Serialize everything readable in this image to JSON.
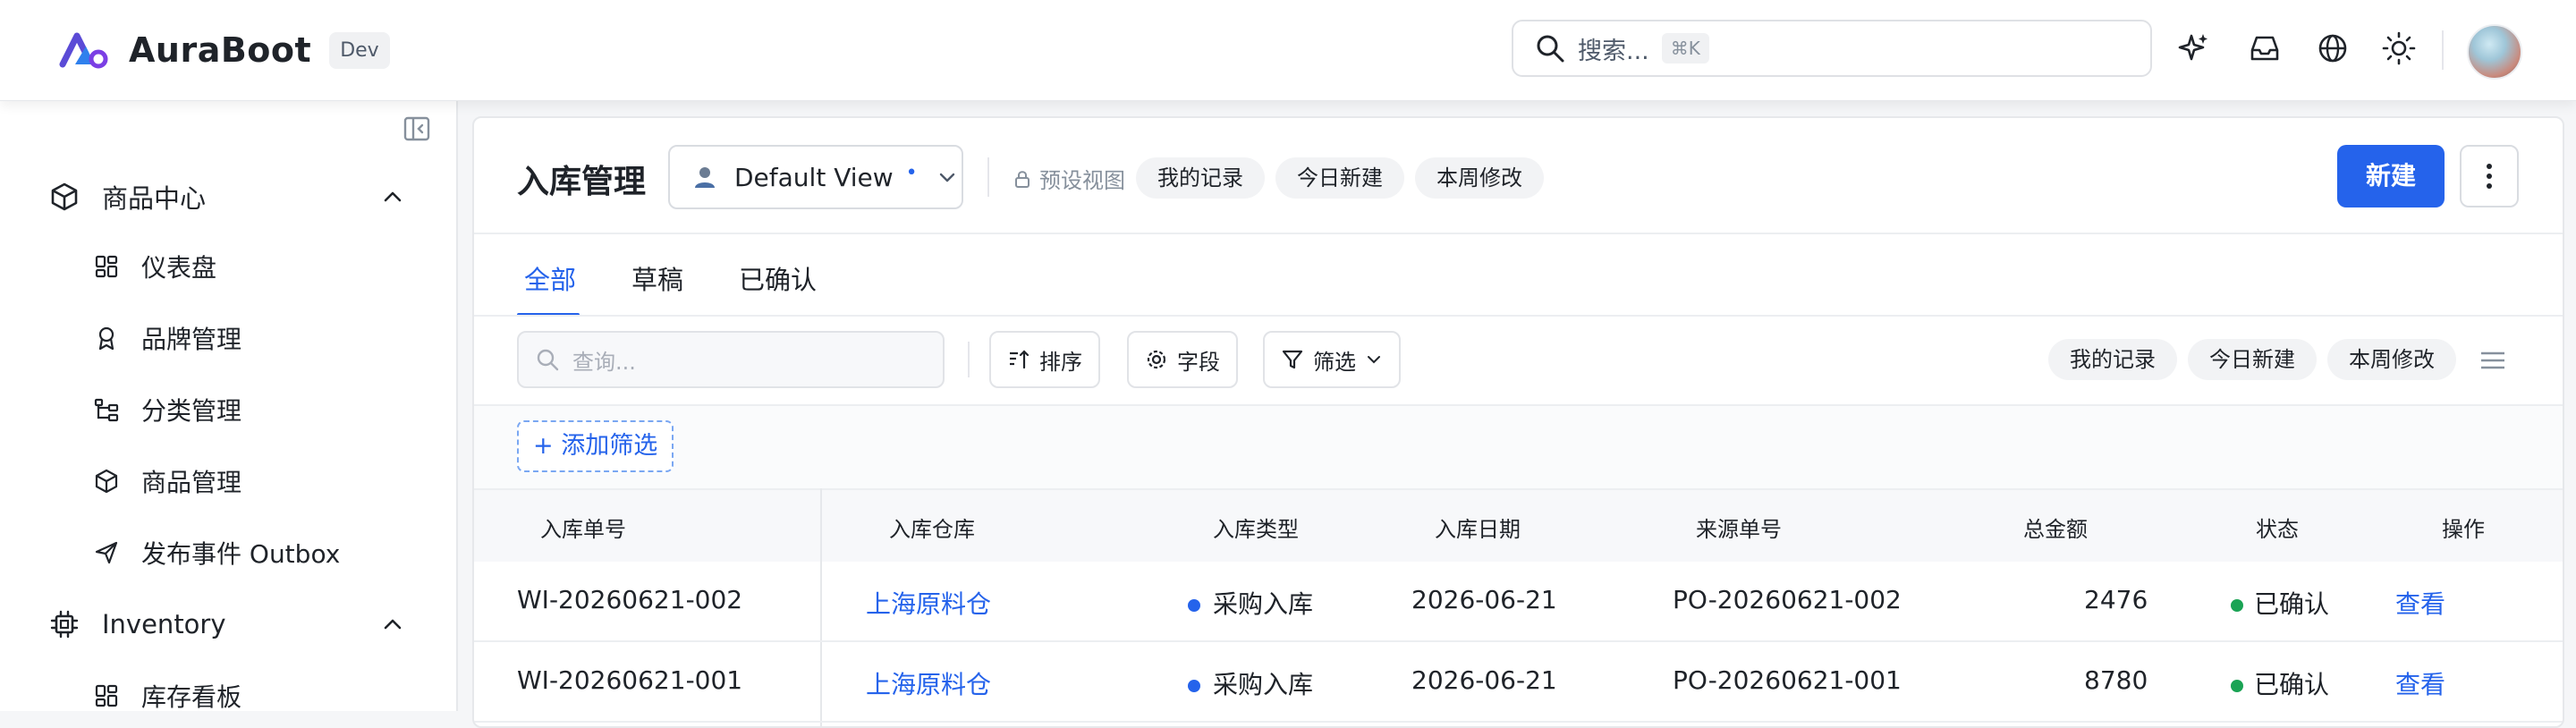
{
  "app": {
    "name": "AuraBoot",
    "env": "Dev"
  },
  "search": {
    "placeholder": "搜索...",
    "shortcut": "⌘K"
  },
  "colors": {
    "accent": "#2563eb",
    "status_confirmed": "#1aa354"
  },
  "header_icons": [
    "sparkle-icon",
    "inbox-icon",
    "globe-icon",
    "sun-icon"
  ],
  "sidebar": {
    "groups": [
      {
        "label": "商品中心",
        "icon": "cube-icon",
        "expanded": true,
        "items": [
          {
            "label": "仪表盘",
            "icon": "dashboard-icon"
          },
          {
            "label": "品牌管理",
            "icon": "badge-icon"
          },
          {
            "label": "分类管理",
            "icon": "tree-icon"
          },
          {
            "label": "商品管理",
            "icon": "cube-icon"
          },
          {
            "label": "发布事件 Outbox",
            "icon": "send-icon"
          }
        ]
      },
      {
        "label": "Inventory",
        "icon": "chip-icon",
        "expanded": true,
        "items": [
          {
            "label": "库存看板",
            "icon": "dashboard-icon"
          }
        ]
      }
    ]
  },
  "page": {
    "title": "入库管理",
    "view": {
      "label": "Default View",
      "modified_mark": "•"
    },
    "preset_label": "预设视图",
    "quick_views": [
      "我的记录",
      "今日新建",
      "本周修改"
    ],
    "new_button": "新建",
    "tabs": [
      "全部",
      "草稿",
      "已确认"
    ],
    "active_tab": 0,
    "query_placeholder": "查询...",
    "toolbar": {
      "sort": "排序",
      "fields": "字段",
      "filter": "筛选"
    },
    "add_filter": "+ 添加筛选"
  },
  "table": {
    "columns": [
      "入库单号",
      "入库仓库",
      "入库类型",
      "入库日期",
      "来源单号",
      "总金额",
      "状态",
      "操作"
    ],
    "rows": [
      {
        "no": "WI-20260621-002",
        "warehouse": "上海原料仓",
        "type": "采购入库",
        "date": "2026-06-21",
        "source": "PO-20260621-002",
        "amount": "2476",
        "status": "已确认",
        "action": "查看"
      },
      {
        "no": "WI-20260621-001",
        "warehouse": "上海原料仓",
        "type": "采购入库",
        "date": "2026-06-21",
        "source": "PO-20260621-001",
        "amount": "8780",
        "status": "已确认",
        "action": "查看"
      }
    ]
  }
}
